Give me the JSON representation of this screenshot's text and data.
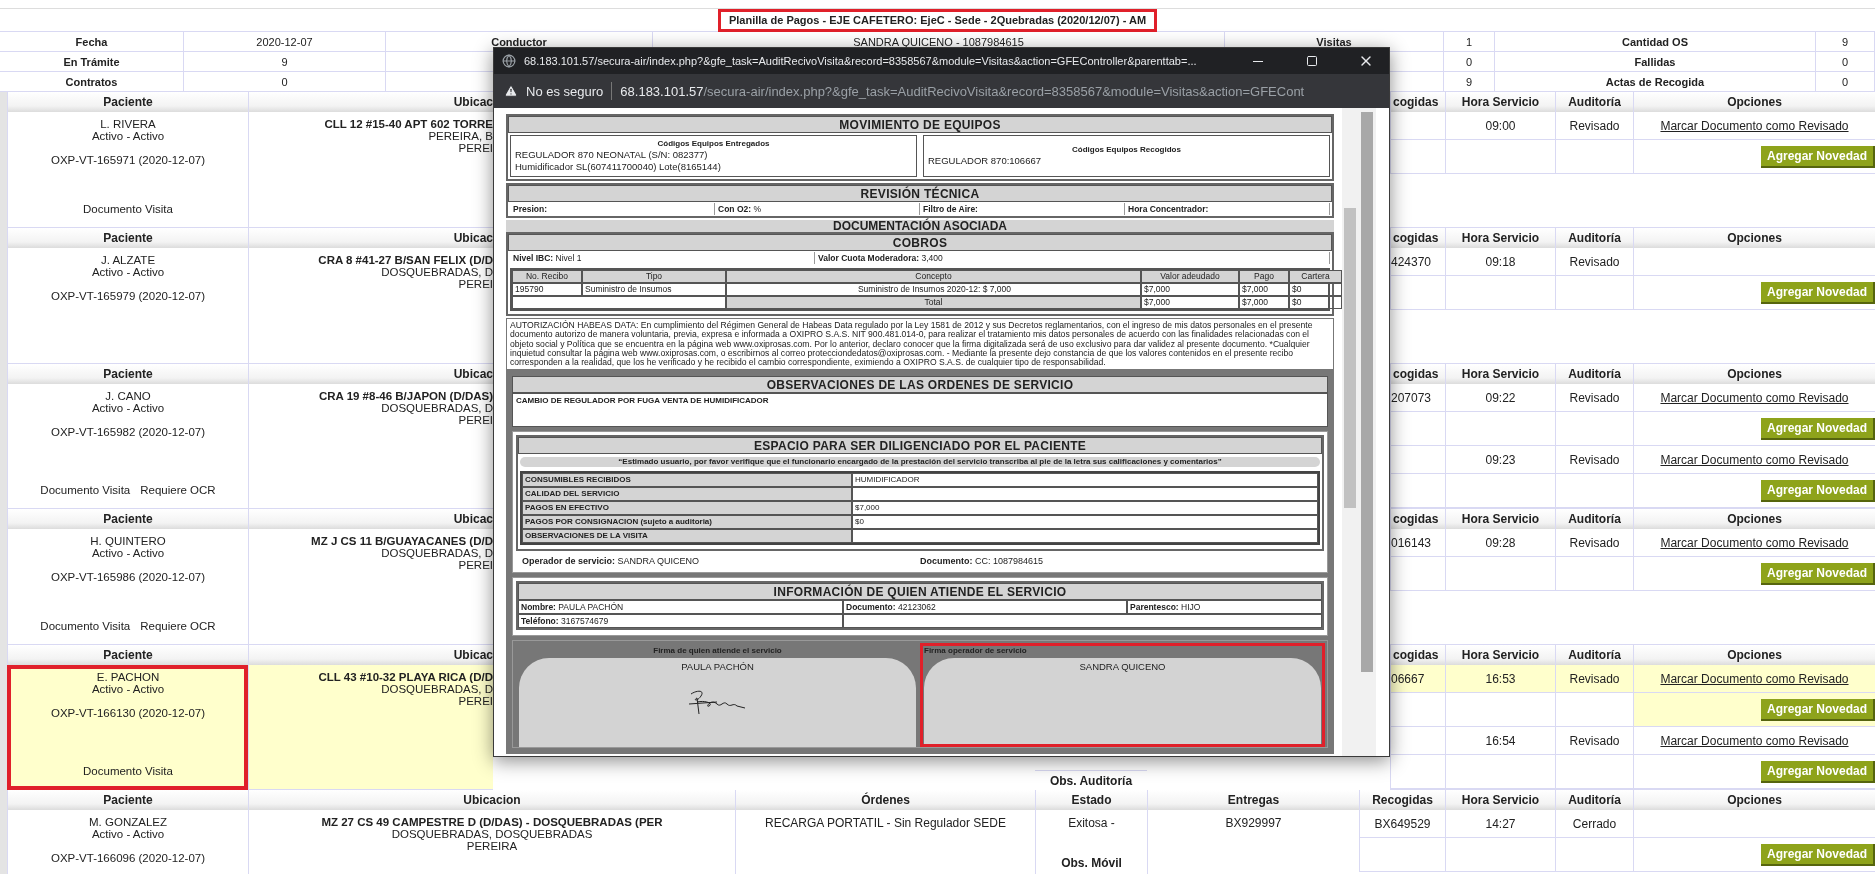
{
  "summary": {
    "title": "Planilla de Pagos - EJE CAFETERO: EjeC - Sede - 2Quebradas (2020/12/07) - AM",
    "marked": true,
    "rows": [
      [
        "Fecha",
        "2020-12-07",
        "Conductor",
        "SANDRA QUICENO - 1087984615",
        "Visitas",
        "1",
        "Cantidad OS",
        "9"
      ],
      [
        "En Trámite",
        "9",
        null,
        null,
        null,
        "0",
        "Fallidas",
        "0"
      ],
      [
        "Contratos",
        "0",
        null,
        null,
        null,
        "9",
        "Actas de Recogida",
        "0"
      ]
    ]
  },
  "visits": [
    {
      "kind": "covered",
      "headers": [
        "Paciente",
        "Ubicac",
        "cogidas",
        "Hora Servicio",
        "Auditoría",
        "Opciones"
      ],
      "highlighted": false,
      "patient": {
        "name": "L. RIVERA",
        "status": "Activo - Activo",
        "code": "OXP-VT-165971 (2020-12-07)",
        "links": [
          "Documento Visita"
        ],
        "marked": false
      },
      "address": [
        "CLL 12 #15-40 APT 602 TORRE",
        "PEREIRA, B",
        "PEREI"
      ],
      "services": [
        {
          "hora": "09:00",
          "auditoria": "Revisado",
          "link": "Marcar Documento como Revisado",
          "button": "Agregar Novedad",
          "highlighted": false
        }
      ]
    },
    {
      "kind": "covered",
      "headers": [
        "Paciente",
        "Ubicac",
        "cogidas",
        "Hora Servicio",
        "Auditoría",
        "Opciones"
      ],
      "highlighted": false,
      "patient": {
        "name": "J. ALZATE",
        "status": "Activo - Activo",
        "code": "OXP-VT-165979 (2020-12-07)",
        "marked": false
      },
      "address": [
        "CRA 8 #41-27 B/SAN FELIX (D/D",
        "DOSQUEBRADAS, D",
        "PEREI"
      ],
      "services": [
        {
          "recogidas": "424370",
          "hora": "09:18",
          "auditoria": "Revisado",
          "button": "Agregar Novedad",
          "highlighted": false
        }
      ]
    },
    {
      "kind": "covered",
      "headers": [
        "Paciente",
        "Ubicac",
        "cogidas",
        "Hora Servicio",
        "Auditoría",
        "Opciones"
      ],
      "highlighted": false,
      "patient": {
        "name": "J. CANO",
        "status": "Activo - Activo",
        "code": "OXP-VT-165982 (2020-12-07)",
        "links": [
          "Documento Visita",
          "Requiere OCR"
        ],
        "marked": false
      },
      "address": [
        "CRA 19 #8-46 B/JAPON (D/DAS)",
        "DOSQUEBRADAS, D",
        "PEREI"
      ],
      "services": [
        {
          "recogidas": "207073",
          "hora": "09:22",
          "auditoria": "Revisado",
          "link": "Marcar Documento como Revisado",
          "button": "Agregar Novedad",
          "highlighted": false
        },
        {
          "hora": "09:23",
          "auditoria": "Revisado",
          "link": "Marcar Documento como Revisado",
          "button": "Agregar Novedad",
          "highlighted": false
        }
      ]
    },
    {
      "kind": "covered",
      "headers": [
        "Paciente",
        "Ubicac",
        "cogidas",
        "Hora Servicio",
        "Auditoría",
        "Opciones"
      ],
      "highlighted": false,
      "patient": {
        "name": "H. QUINTERO",
        "status": "Activo - Activo",
        "code": "OXP-VT-165986 (2020-12-07)",
        "links": [
          "Documento Visita",
          "Requiere OCR"
        ],
        "marked": false
      },
      "address": [
        "MZ J CS 11 B/GUAYACANES (D/D",
        "DOSQUEBRADAS, D",
        "PEREI"
      ],
      "services": [
        {
          "recogidas": "016143",
          "hora": "09:28",
          "auditoria": "Revisado",
          "link": "Marcar Documento como Revisado",
          "button": "Agregar Novedad",
          "highlighted": false
        }
      ]
    },
    {
      "kind": "covered",
      "headers": [
        "Paciente",
        "Ubicac",
        "cogidas",
        "Hora Servicio",
        "Auditoría",
        "Opciones"
      ],
      "highlighted": true,
      "patient": {
        "name": "E. PACHON",
        "status": "Activo - Activo",
        "code": "OXP-VT-166130 (2020-12-07)",
        "links": [
          "Documento Visita"
        ],
        "marked": true
      },
      "address": [
        "CLL 43 #10-32 PLAYA RICA (D/D",
        "DOSQUEBRADAS, D",
        "PEREI"
      ],
      "services": [
        {
          "recogidas": "06667",
          "hora": "16:53",
          "auditoria": "Revisado",
          "link": "Marcar Documento como Revisado",
          "button": "Agregar Novedad",
          "highlighted": true
        },
        {
          "hora": "16:54",
          "auditoria": "Revisado",
          "link": "Marcar Documento como Revisado",
          "button": "Agregar Novedad",
          "highlighted": false
        }
      ],
      "obs": [
        "Obs. Auditoría"
      ]
    },
    {
      "kind": "full",
      "headers": [
        "Paciente",
        "Ubicacion",
        "Órdenes",
        "Estado",
        "Entregas",
        "Recogidas",
        "Hora Servicio",
        "Auditoría",
        "Opciones"
      ],
      "highlighted": false,
      "patient": {
        "name": "M. GONZALEZ",
        "status": "Activo - Activo",
        "code": "OXP-VT-166096 (2020-12-07)",
        "marked": false
      },
      "address": [
        "MZ 27 CS 49 CAMPESTRE D (D/DAS) - DOSQUEBRADAS (PER",
        "DOSQUEBRADAS, DOSQUEBRADAS",
        "PEREIRA"
      ],
      "orden": "RECARGA PORTATIL - Sin Regulador SEDE",
      "estado": "Exitosa -",
      "entregas": "BX929997",
      "services": [
        {
          "recogidas": "BX649529",
          "hora": "14:27",
          "auditoria": "Cerrado",
          "button": "Agregar Novedad",
          "highlighted": false
        }
      ],
      "obs": [
        "Obs. Móvil"
      ]
    }
  ],
  "popup": {
    "title_url": "68.183.101.57/secura-air/index.php?&gfe_task=AuditRecivoVisita&record=8358567&module=Visitas&action=GFEController&parenttab=...",
    "security": "No es seguro",
    "host": "68.183.101.57",
    "path": "/secura-air/index.php?&gfe_task=AuditRecivoVisita&record=8358567&module=Visitas&action=GFECont",
    "document": {
      "equipment": {
        "title": "MOVIMIENTO DE EQUIPOS",
        "delivered": {
          "heading": "Códigos Equipos Entregados",
          "lines": [
            "REGULADOR 870 NEONATAL (S/N: 082377)",
            "Humidificador SL(607411700040) Lote(8165144)"
          ]
        },
        "collected": {
          "heading": "Códigos Equipos Recogidos",
          "lines": [
            "REGULADOR 870:106667"
          ]
        }
      },
      "technical": {
        "title": "REVISIÓN TÉCNICA",
        "fields": [
          {
            "label": "Presion:"
          },
          {
            "label": "Con O2:",
            "value": "%"
          },
          {
            "label": "Filtro de Aire:"
          },
          {
            "label": "Hora Concentrador:"
          }
        ]
      },
      "documentation_title": "DOCUMENTACIÓN ASOCIADA",
      "charges": {
        "title": "COBROS",
        "fields": [
          {
            "label": "Nivel IBC:",
            "value": "Nivel 1"
          },
          {
            "label": "Valor Cuota Moderadora:",
            "value": "3,400"
          }
        ],
        "columns": [
          "No. Recibo",
          "Tipo",
          "Concepto",
          "Valor adeudado",
          "Pago",
          "Cartera"
        ],
        "rows": [
          [
            "195790",
            "Suministro de Insumos",
            "Suministro de Insumos 2020-12: $ 7,000",
            "$7,000",
            "$7,000",
            "$0"
          ]
        ],
        "total": {
          "label": "Total",
          "values": [
            "$7,000",
            "$7,000",
            "$0"
          ]
        }
      },
      "consent": "AUTORIZACIÓN HABEAS DATA: En cumplimiento del Régimen General de Habeas Data regulado por la Ley 1581 de 2012 y sus Decretos reglamentarios, con el ingreso de mis datos personales en el presente documento autorizo de manera voluntaria, previa, expresa e informada a OXIPRO S.A.S. NIT 900.481.014-0, para realizar el tratamiento mis datos personales de acuerdo con las finalidades relacionadas con el objeto social y Política que se encuentra en la página web www.oxiprosas.com. Por lo anterior, declaro conocer que la firma digitalizada será de uso exclusivo para dar validez al presente documento. *Cualquier inquietud consultar la página web www.oxiprosas.com, o escribirnos al correo protecciondedatos@oxiprosas.com. - Mediante la presente dejo constancia de que los valores contenidos en el presente recibo corresponden a la realidad, que los he verificado y he recibido el cambio correspondiente, eximiendo a OXIPRO S.A.S. de cualquier tipo de responsabilidad.",
      "observations": {
        "title": "OBSERVACIONES DE LAS ORDENES DE SERVICIO",
        "text": "CAMBIO DE REGULADOR POR FUGA VENTA DE HUMIDIFICADOR"
      },
      "patient_space": {
        "title": "ESPACIO PARA SER DILIGENCIADO POR EL PACIENTE",
        "note": "“Estimado usuario, por favor verifique que el funcionario encargado de la prestación del servicio transcriba al pie de la letra sus calificaciones y comentarios”",
        "rows": [
          {
            "label": "CONSUMIBLES RECIBIDOS",
            "value": "HUMIDIFICADOR"
          },
          {
            "label": "CALIDAD DEL SERVICIO"
          },
          {
            "label": "PAGOS EN EFECTIVO",
            "value": "$7,000"
          },
          {
            "label": "PAGOS POR CONSIGNACION (sujeto a auditoria)",
            "value": "$0"
          },
          {
            "label": "OBSERVACIONES DE LA VISITA"
          }
        ],
        "operator": {
          "label": "Operador de servicio:",
          "value": "SANDRA QUICENO"
        },
        "document": {
          "label": "Documento:",
          "value": "CC: 1087984615"
        }
      },
      "attendee": {
        "title": "INFORMACIÓN DE QUIEN ATIENDE EL SERVICIO",
        "fields": [
          {
            "label": "Nombre:",
            "value": "PAULA PACHÓN"
          },
          {
            "label": "Documento:",
            "value": "42123062"
          },
          {
            "label": "Parentesco:",
            "value": "HIJO"
          },
          {
            "label": "Teléfono:",
            "value": "3167574679"
          }
        ]
      },
      "signatures": [
        {
          "label": "Firma de quien atiende el servicio",
          "name": "PAULA PACHÓN",
          "signed": true,
          "marked": false
        },
        {
          "label": "Firma operador de servicio",
          "name": "SANDRA QUICENO",
          "signed": false,
          "marked": true
        }
      ]
    }
  }
}
